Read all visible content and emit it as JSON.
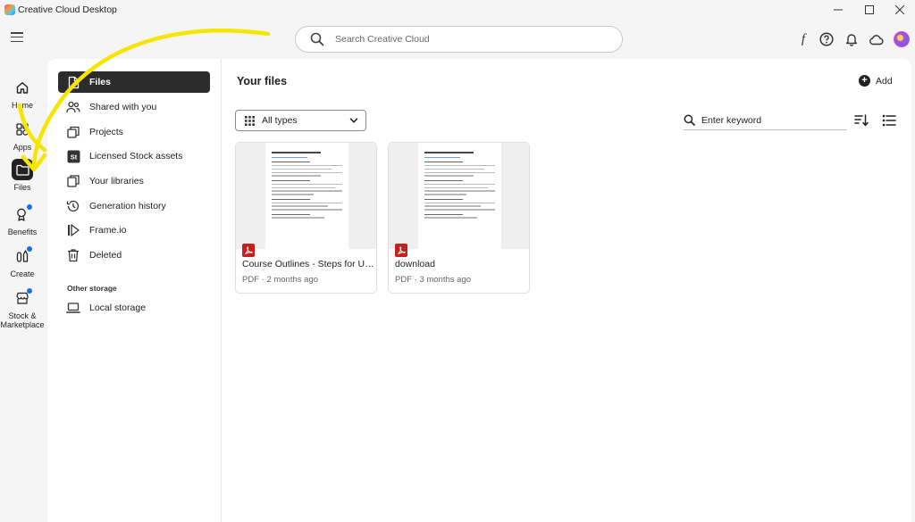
{
  "window": {
    "title": "Creative Cloud Desktop",
    "controls": [
      "minimize",
      "maximize",
      "close"
    ]
  },
  "toolbar": {
    "search_placeholder": "Search Creative Cloud",
    "icons": [
      "menu-icon",
      "fonts-icon",
      "help-icon",
      "bell-icon",
      "cloud-icon",
      "avatar"
    ]
  },
  "rail": {
    "items": [
      {
        "label": "Home",
        "icon": "home-icon"
      },
      {
        "label": "Apps",
        "icon": "apps-icon"
      },
      {
        "label": "Files",
        "icon": "folder-icon",
        "active": true
      },
      {
        "label": "Benefits",
        "icon": "benefits-icon",
        "badge": true
      },
      {
        "label": "Create",
        "icon": "create-icon",
        "badge": true
      },
      {
        "label": "Stock &",
        "label2": "Marketplace",
        "icon": "stock-icon",
        "badge": true
      }
    ]
  },
  "subnav": {
    "items": [
      {
        "label": "Files",
        "icon": "file-icon",
        "active": true
      },
      {
        "label": "Shared with you",
        "icon": "shared-icon"
      },
      {
        "label": "Projects",
        "icon": "projects-icon"
      },
      {
        "label": "Licensed Stock assets",
        "icon": "stock-st-icon"
      },
      {
        "label": "Your libraries",
        "icon": "libraries-icon"
      },
      {
        "label": "Generation history",
        "icon": "history-icon"
      },
      {
        "label": "Frame.io",
        "icon": "frameio-icon"
      },
      {
        "label": "Deleted",
        "icon": "trash-icon"
      }
    ],
    "other_storage_heading": "Other storage",
    "local_storage": {
      "label": "Local storage",
      "icon": "laptop-icon"
    }
  },
  "main": {
    "title": "Your files",
    "add_label": "Add",
    "filter_value": "All types",
    "keyword_placeholder": "Enter keyword",
    "files": [
      {
        "name": "Course Outlines - Steps for Upd...",
        "meta": "PDF · 2 months ago",
        "type_icon": "pdf-icon"
      },
      {
        "name": "download",
        "meta": "PDF · 3 months ago",
        "type_icon": "pdf-icon"
      }
    ]
  },
  "colors": {
    "annotation_arrow": "#f6e500",
    "active_nav": "#2c2c2c",
    "badge": "#1473e6",
    "pdf": "#c5221f"
  }
}
